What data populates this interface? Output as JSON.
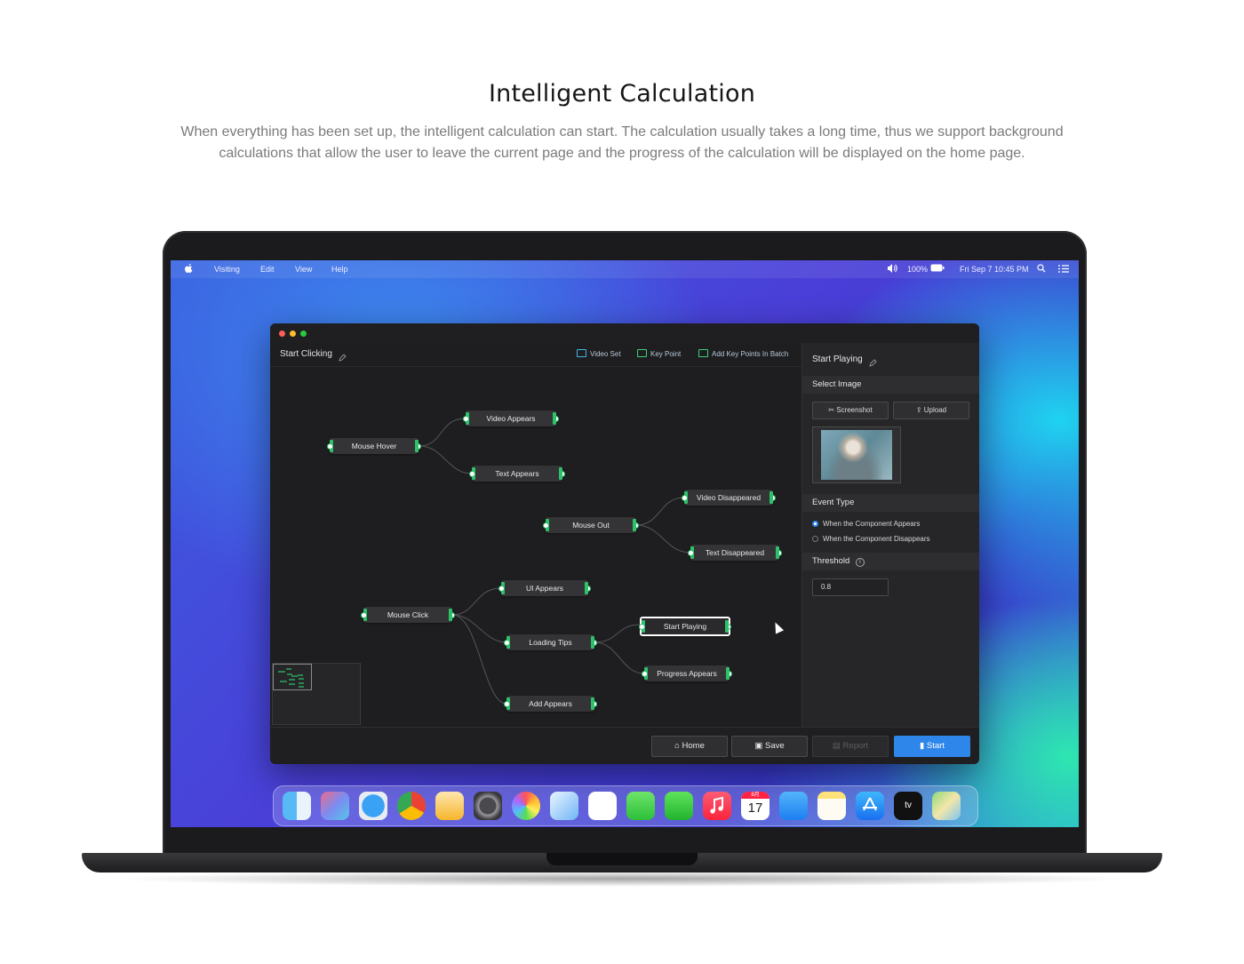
{
  "page": {
    "title": "Intelligent Calculation",
    "subtitle": "When everything has been set up, the intelligent calculation can start. The calculation usually takes a long time, thus we support background calculations that allow the user to leave the current page and the progress of the calculation will be displayed on the home page."
  },
  "menubar": {
    "items": [
      "Visiting",
      "Edit",
      "View",
      "Help"
    ],
    "battery": "100%",
    "datetime": "Fri Sep 7 10:45 PM"
  },
  "canvas": {
    "title": "Start Clicking",
    "toolbar": [
      "Video Set",
      "Key Point",
      "Add Key Points In Batch"
    ],
    "nodes": [
      "Mouse Hover",
      "Video Appears",
      "Text Appears",
      "Mouse Out",
      "Video Disappeared",
      "Text Disappeared",
      "Mouse Click",
      "UI Appears",
      "Loading Tips",
      "Start Playing",
      "Progress Appears",
      "Add Appears"
    ]
  },
  "panel": {
    "title": "Start Playing",
    "select_image": "Select Image",
    "screenshot_btn": "Screenshot",
    "upload_btn": "Upload",
    "event_type": "Event Type",
    "radio_appears": "When the Component Appears",
    "radio_disappears": "When the Component Disappears",
    "selected_event": "When the Component Appears",
    "threshold": "Threshold",
    "threshold_value": "0.8"
  },
  "footer": {
    "home": "Home",
    "save": "Save",
    "report": "Report",
    "start": "Start"
  },
  "dock": {
    "calendar_month": "8月",
    "calendar_day": "17",
    "tv_label": "tv"
  },
  "colors": {
    "accent": "#2e86ea",
    "node_border": "#2ec06a"
  }
}
